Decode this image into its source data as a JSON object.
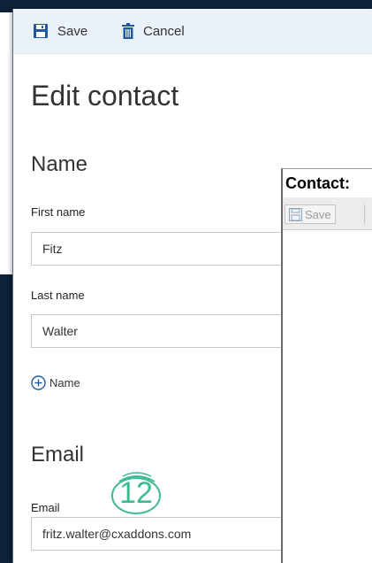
{
  "toolbar": {
    "save_label": "Save",
    "cancel_label": "Cancel"
  },
  "form": {
    "title": "Edit contact",
    "name_section": "Name",
    "first_name_label": "First name",
    "first_name_value": "Fitz",
    "last_name_label": "Last name",
    "last_name_value": "Walter",
    "add_name_label": "Name",
    "email_section": "Email",
    "email_label": "Email",
    "email_value": "fritz.walter@cxaddons.com"
  },
  "annotation": {
    "step_number": "12",
    "color": "#3dbb8f"
  },
  "overlay_window": {
    "title": "Contact:",
    "save_label": "Save"
  },
  "icons": {
    "save": "floppy-disk-icon",
    "cancel": "trash-icon",
    "add": "plus-circle-icon"
  },
  "colors": {
    "frame": "#0d2238",
    "toolbar_bg": "#eaf1f8",
    "accent_blue": "#1f5aa0"
  }
}
